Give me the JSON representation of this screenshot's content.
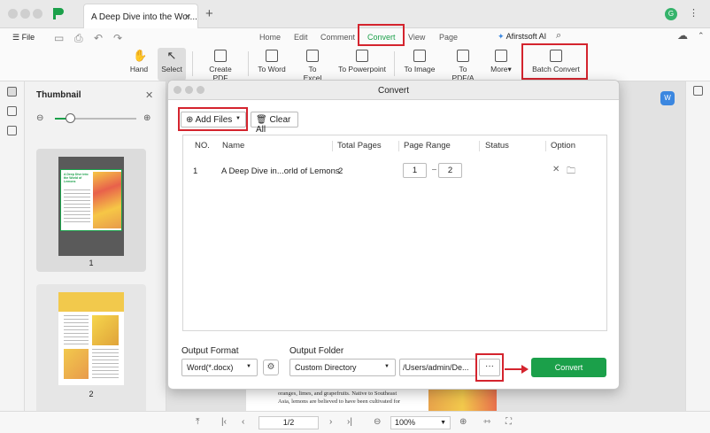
{
  "tabbar": {
    "tab_title": "A Deep Dive into the Wor...",
    "tab_close": "×",
    "new_tab": "+",
    "user_initial": "G",
    "more_menu": "⋮"
  },
  "menubar": {
    "file_label": "File",
    "nav_tabs": [
      "Home",
      "Edit",
      "Comment",
      "Convert",
      "View",
      "Page"
    ],
    "active_tab": "Convert",
    "ai_label": "Afirstsoft AI"
  },
  "toolbar": {
    "hand": "Hand",
    "select": "Select",
    "create_pdf": "Create PDF",
    "to_word": "To Word",
    "to_excel": "To Excel",
    "to_powerpoint": "To Powerpoint",
    "to_image": "To Image",
    "to_pdfa": "To PDF/A",
    "more": "More▾",
    "batch_convert": "Batch Convert"
  },
  "sidebar": {
    "title": "Thumbnail",
    "zoom_level": 0.2,
    "thumbnails": [
      {
        "page_number": "1",
        "mini_title": "A Deep Dive into the World of Lemons"
      },
      {
        "page_number": "2"
      }
    ]
  },
  "dialog": {
    "title": "Convert",
    "add_files": "Add Files",
    "clear_all": "Clear All",
    "columns": [
      "NO.",
      "Name",
      "Total Pages",
      "Page Range",
      "Status",
      "Option"
    ],
    "rows": [
      {
        "no": "1",
        "name": "A Deep Dive in...orld of Lemons",
        "total_pages": "2",
        "range_from": "1",
        "range_to": "2",
        "status": ""
      }
    ],
    "output_format_label": "Output Format",
    "output_format_value": "Word(*.docx)",
    "output_folder_label": "Output Folder",
    "output_folder_value": "Custom Directory",
    "output_path": "/Users/admin/De...",
    "more_btn": "···",
    "convert_btn": "Convert"
  },
  "doc_preview": {
    "line1": "oranges, limes, and grapefruits. Native to Southeast",
    "line2": "Asia, lemons are believed to have been cultivated for"
  },
  "statusbar": {
    "page_indicator": "1/2",
    "zoom": "100%"
  },
  "colors": {
    "accent": "#1ba04a",
    "highlight": "#d4242e"
  }
}
